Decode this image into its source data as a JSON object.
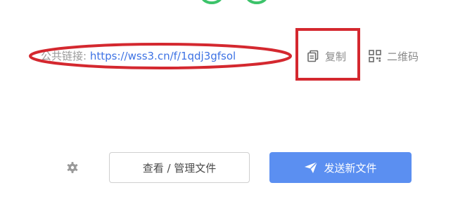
{
  "share": {
    "label": "公共链接:",
    "url": "https://wss3.cn/f/1qdj3gfsol"
  },
  "actions": {
    "copy_label": "复制",
    "qrcode_label": "二维码"
  },
  "footer": {
    "view_manage_label": "查看 / 管理文件",
    "send_new_label": "发送新文件"
  },
  "colors": {
    "link": "#3d72e4",
    "primary_button": "#5b8ff1",
    "annotation_red": "#d4282f",
    "logo_green": "#3cc36a",
    "logo_teal": "#1fb5a8"
  },
  "icons": {
    "copy": "copy-icon",
    "qrcode": "qrcode-icon",
    "settings": "gear-icon",
    "send": "paper-plane-icon"
  }
}
